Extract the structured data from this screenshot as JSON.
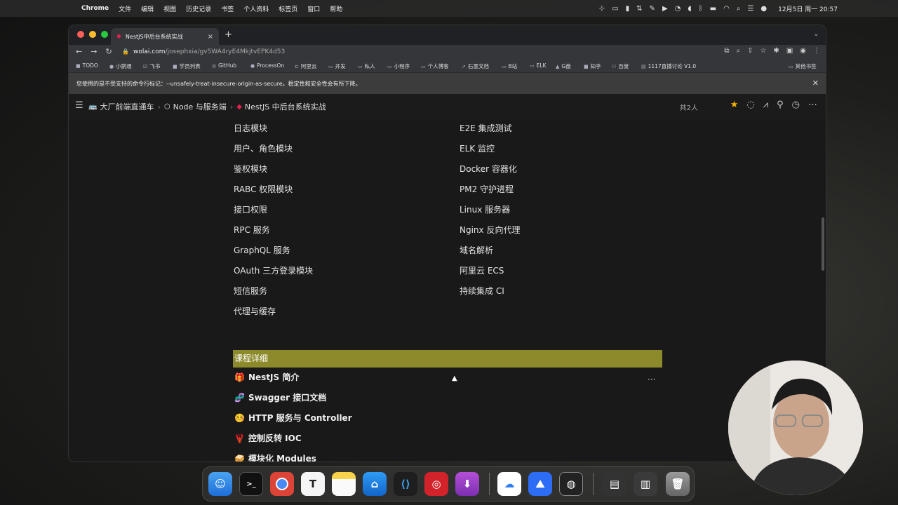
{
  "menubar": {
    "app": "Chrome",
    "items": [
      "文件",
      "编辑",
      "视图",
      "历史记录",
      "书签",
      "个人资料",
      "标签页",
      "窗口",
      "帮助"
    ],
    "clock": "12月5日 周一 20:57"
  },
  "browser": {
    "tab_title": "NestJS中后台系统实战",
    "url_host": "wolai.com",
    "url_path": "/josephxia/gv5WA4ryE4MkjtvEPK4d53",
    "bookmarks": [
      "TODO",
      "小鹅通",
      "飞书",
      "学员列表",
      "GitHub",
      "ProcessOn",
      "阿里云",
      "开发",
      "私人",
      "小程序",
      "个人博客",
      "石墨文档",
      "B站",
      "ELK",
      "G盘",
      "知乎",
      "百度",
      "1117直播讨论 V1.0"
    ],
    "other_bookmarks": "其他书签",
    "infobar": "您使用的是不受支持的命令行标记：--unsafely-treat-insecure-origin-as-secure。稳定性和安全性会有所下降。"
  },
  "page": {
    "breadcrumbs": [
      "大厂前端直通车",
      "Node 与服务端",
      "NestJS 中后台系统实战"
    ],
    "collaborators": "共2人",
    "left_column": [
      "日志模块",
      "用户、角色模块",
      "鉴权模块",
      "RABC 权限模块",
      "接口权限",
      "RPC 服务",
      "GraphQL 服务",
      "OAuth 三方登录模块",
      "短信服务",
      "代理与缓存"
    ],
    "right_column": [
      "E2E 集成测试",
      "ELK 监控",
      "Docker 容器化",
      "PM2 守护进程",
      "Linux 服务器",
      "Nginx 反向代理",
      "域名解析",
      "阿里云 ECS",
      "持续集成 CI"
    ],
    "section_title": "课程详细",
    "details": [
      {
        "emoji": "🎁",
        "title": "NestJS 简介"
      },
      {
        "emoji": "🧬",
        "title": "Swagger 接口文档"
      },
      {
        "emoji": "🤒",
        "title": "HTTP 服务与 Controller"
      },
      {
        "emoji": "🦞",
        "title": "控制反转 IOC"
      },
      {
        "emoji": "🥪",
        "title": "模块化 Modules"
      }
    ],
    "more": "···"
  },
  "colors": {
    "section_bar": "#8c8a2b",
    "star": "#f4b400",
    "background": "#191919"
  }
}
